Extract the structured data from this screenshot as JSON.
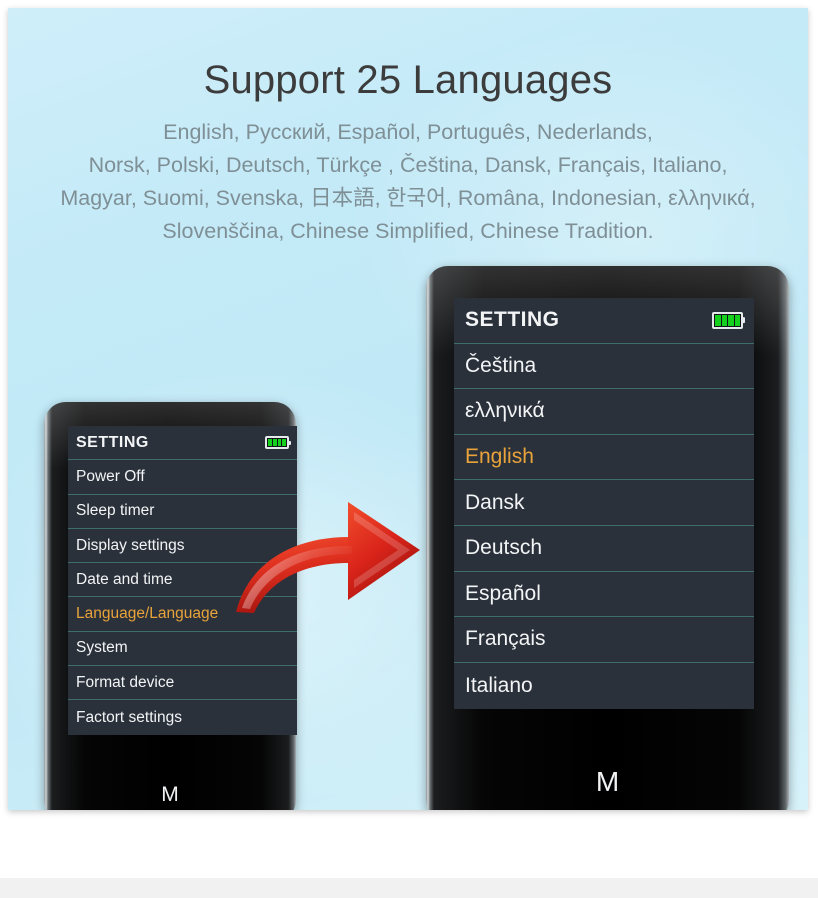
{
  "banner": {
    "headline": "Support 25 Languages",
    "languages_paragraph": "English, Русский, Español, Português, Nederlands,\nNorsk, Polski, Deutsch, Türkçe , Čeština, Dansk, Français, Italiano,\nMagyar, Suomi, Svenska, 日本語, 한국어, Româna, Indonesian, ελληνικά,\nSlovenščina, Chinese Simplified, Chinese Tradition.",
    "background_color": "#c4eaf7",
    "headline_color": "#3c3c3c",
    "languages_color": "#7f8f96"
  },
  "colors": {
    "lcd_background": "#2b313a",
    "lcd_divider": "#3d6d6b",
    "lcd_text": "#f2f4f6",
    "highlight_orange": "#e8a33a",
    "battery_green": "#15d11d",
    "arrow_red": "#d8261d"
  },
  "arrow": {
    "name": "curved-right-arrow",
    "color": "#d8261d",
    "direction": "right"
  },
  "device_left": {
    "name": "mp3-player-settings-menu",
    "screen_title": "SETTING",
    "battery_label": "battery-full",
    "battery_bars": 4,
    "menu_items": [
      {
        "label": "Power Off",
        "selected": false
      },
      {
        "label": "Sleep timer",
        "selected": false
      },
      {
        "label": "Display settings",
        "selected": false
      },
      {
        "label": "Date and time",
        "selected": false
      },
      {
        "label": "Language/Language",
        "selected": true
      },
      {
        "label": "System",
        "selected": false
      },
      {
        "label": "Format device",
        "selected": false
      },
      {
        "label": "Factort settings",
        "selected": false
      }
    ],
    "m_button": "M"
  },
  "device_right": {
    "name": "mp3-player-language-menu",
    "screen_title": "SETTING",
    "battery_label": "battery-full",
    "battery_bars": 4,
    "menu_items": [
      {
        "label": "Čeština",
        "selected": false
      },
      {
        "label": "ελληνικά",
        "selected": false
      },
      {
        "label": "English",
        "selected": true
      },
      {
        "label": "Dansk",
        "selected": false
      },
      {
        "label": "Deutsch",
        "selected": false
      },
      {
        "label": "Español",
        "selected": false
      },
      {
        "label": "Français",
        "selected": false
      },
      {
        "label": "Italiano",
        "selected": false
      }
    ],
    "m_button": "M"
  }
}
